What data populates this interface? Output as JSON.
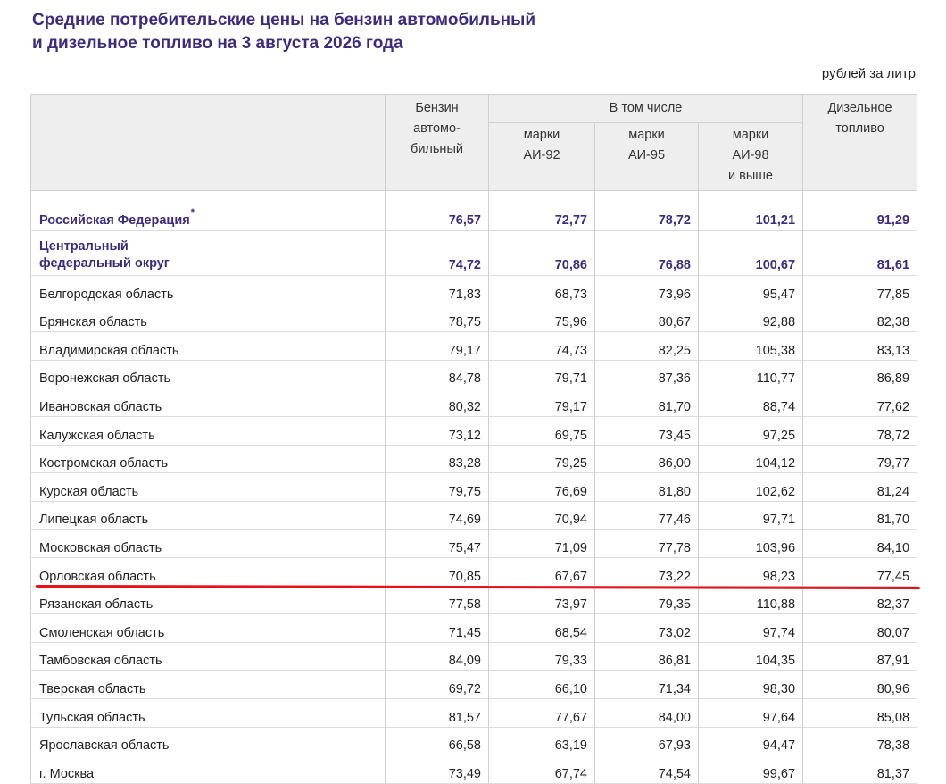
{
  "title": {
    "line1": "Средние потребительские цены на бензин автомобильный",
    "line2": "и дизельное топливо на 3 августа 2026 года"
  },
  "unit": "рублей за литр",
  "header": {
    "gasoline": [
      "Бензин",
      "автомо-",
      "бильный"
    ],
    "including": "В том числе",
    "ai92": [
      "марки",
      "АИ-92"
    ],
    "ai95": [
      "марки",
      "АИ-95"
    ],
    "ai98": [
      "марки",
      "АИ-98",
      "и выше"
    ],
    "diesel": [
      "Дизельное",
      "топливо"
    ]
  },
  "summary_rows": [
    {
      "name": "Российская Федерация",
      "mark": "*",
      "values": [
        "76,57",
        "72,77",
        "78,72",
        "101,21",
        "91,29"
      ]
    },
    {
      "name_lines": [
        "Центральный",
        "федеральный округ"
      ],
      "values": [
        "74,72",
        "70,86",
        "76,88",
        "100,67",
        "81,61"
      ]
    }
  ],
  "rows": [
    {
      "name": "Белгородская область",
      "values": [
        "71,83",
        "68,73",
        "73,96",
        "95,47",
        "77,85"
      ]
    },
    {
      "name": "Брянская область",
      "values": [
        "78,75",
        "75,96",
        "80,67",
        "92,88",
        "82,38"
      ]
    },
    {
      "name": "Владимирская область",
      "values": [
        "79,17",
        "74,73",
        "82,25",
        "105,38",
        "83,13"
      ]
    },
    {
      "name": "Воронежская область",
      "values": [
        "84,78",
        "79,71",
        "87,36",
        "110,77",
        "86,89"
      ]
    },
    {
      "name": "Ивановская область",
      "values": [
        "80,32",
        "79,17",
        "81,70",
        "88,74",
        "77,62"
      ]
    },
    {
      "name": "Калужская область",
      "values": [
        "73,12",
        "69,75",
        "73,45",
        "97,25",
        "78,72"
      ]
    },
    {
      "name": "Костромская область",
      "values": [
        "83,28",
        "79,25",
        "86,00",
        "104,12",
        "79,77"
      ]
    },
    {
      "name": "Курская область",
      "values": [
        "79,75",
        "76,69",
        "81,80",
        "102,62",
        "81,24"
      ]
    },
    {
      "name": "Липецкая область",
      "values": [
        "74,69",
        "70,94",
        "77,46",
        "97,71",
        "81,70"
      ]
    },
    {
      "name": "Московская область",
      "values": [
        "75,47",
        "71,09",
        "77,78",
        "103,96",
        "84,10"
      ]
    },
    {
      "name": "Орловская область",
      "values": [
        "70,85",
        "67,67",
        "73,22",
        "98,23",
        "77,45"
      ]
    },
    {
      "name": "Рязанская область",
      "values": [
        "77,58",
        "73,97",
        "79,35",
        "110,88",
        "82,37"
      ]
    },
    {
      "name": "Смоленская область",
      "values": [
        "71,45",
        "68,54",
        "73,02",
        "97,74",
        "80,07"
      ]
    },
    {
      "name": "Тамбовская область",
      "values": [
        "84,09",
        "79,33",
        "86,81",
        "104,35",
        "87,91"
      ]
    },
    {
      "name": "Тверская область",
      "values": [
        "69,72",
        "66,10",
        "71,34",
        "98,30",
        "80,96"
      ]
    },
    {
      "name": "Тульская область",
      "values": [
        "81,57",
        "77,67",
        "84,00",
        "97,64",
        "85,08"
      ]
    },
    {
      "name": "Ярославская область",
      "values": [
        "66,58",
        "63,19",
        "67,93",
        "94,47",
        "78,38"
      ]
    },
    {
      "name": "г. Москва",
      "values": [
        "73,49",
        "67,74",
        "74,54",
        "99,67",
        "81,37"
      ]
    }
  ],
  "annotation": {
    "color": "#e8111a",
    "underlined_row": "Рязанская область"
  },
  "colors": {
    "title": "#3b2c7e",
    "header_bg": "#eeeeee",
    "highlight": "#3b2c7e"
  }
}
